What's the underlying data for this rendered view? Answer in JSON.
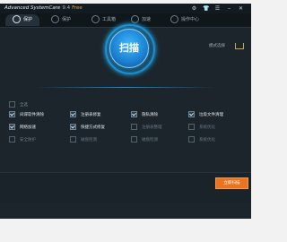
{
  "titlebar": {
    "app_name": "Advanced SystemCare",
    "version": "9.4",
    "edition": "Free",
    "icons": [
      "gear-icon",
      "shirt-icon",
      "menu-icon",
      "minimize-icon",
      "close-icon"
    ]
  },
  "tabs": [
    {
      "label": "保护"
    },
    {
      "label": "保护"
    },
    {
      "label": "工具箱"
    },
    {
      "label": "加速"
    },
    {
      "label": "操作中心"
    }
  ],
  "hero": {
    "scan_label": "扫描",
    "mode_label": "模式选择"
  },
  "select_all": "全选",
  "options": [
    {
      "label": "间谍软件清除",
      "checked": true
    },
    {
      "label": "注册表修复",
      "checked": true
    },
    {
      "label": "隐私清除",
      "checked": true
    },
    {
      "label": "垃圾文件清理",
      "checked": true
    },
    {
      "label": "网络加速",
      "checked": true
    },
    {
      "label": "快捷方式修复",
      "checked": true
    },
    {
      "label": "注册表整理",
      "checked": false
    },
    {
      "label": "系统优化",
      "checked": false
    },
    {
      "label": "安全防护",
      "checked": false
    },
    {
      "label": "磁盘检测",
      "checked": false
    },
    {
      "label": "磁盘检测",
      "checked": false
    },
    {
      "label": "系统优化",
      "checked": false
    }
  ],
  "scan_now_label": "立即扫描"
}
